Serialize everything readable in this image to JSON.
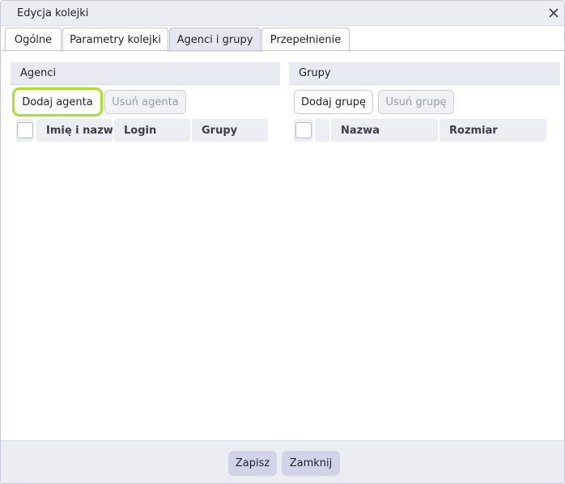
{
  "dialog": {
    "title": "Edycja kolejki"
  },
  "tabs": [
    {
      "label": "Ogólne"
    },
    {
      "label": "Parametry kolejki"
    },
    {
      "label": "Agenci i grupy"
    },
    {
      "label": "Przepełnienie"
    }
  ],
  "active_tab": "Agenci i grupy",
  "agents": {
    "title": "Agenci",
    "add_label": "Dodaj agenta",
    "remove_label": "Usuń agenta",
    "columns": [
      "Imię i nazwisko",
      "Login",
      "Grupy"
    ]
  },
  "groups": {
    "title": "Grupy",
    "add_label": "Dodaj grupę",
    "remove_label": "Usuń grupę",
    "columns": [
      "Nazwa",
      "Rozmiar"
    ]
  },
  "footer": {
    "save_label": "Zapisz",
    "close_label": "Zamknij"
  },
  "colors": {
    "focus_outline": "#a6e22e",
    "footer_button": "#d3d3e8",
    "active_tab": "#e5e6f1"
  },
  "icons": {
    "close": "close-icon"
  }
}
